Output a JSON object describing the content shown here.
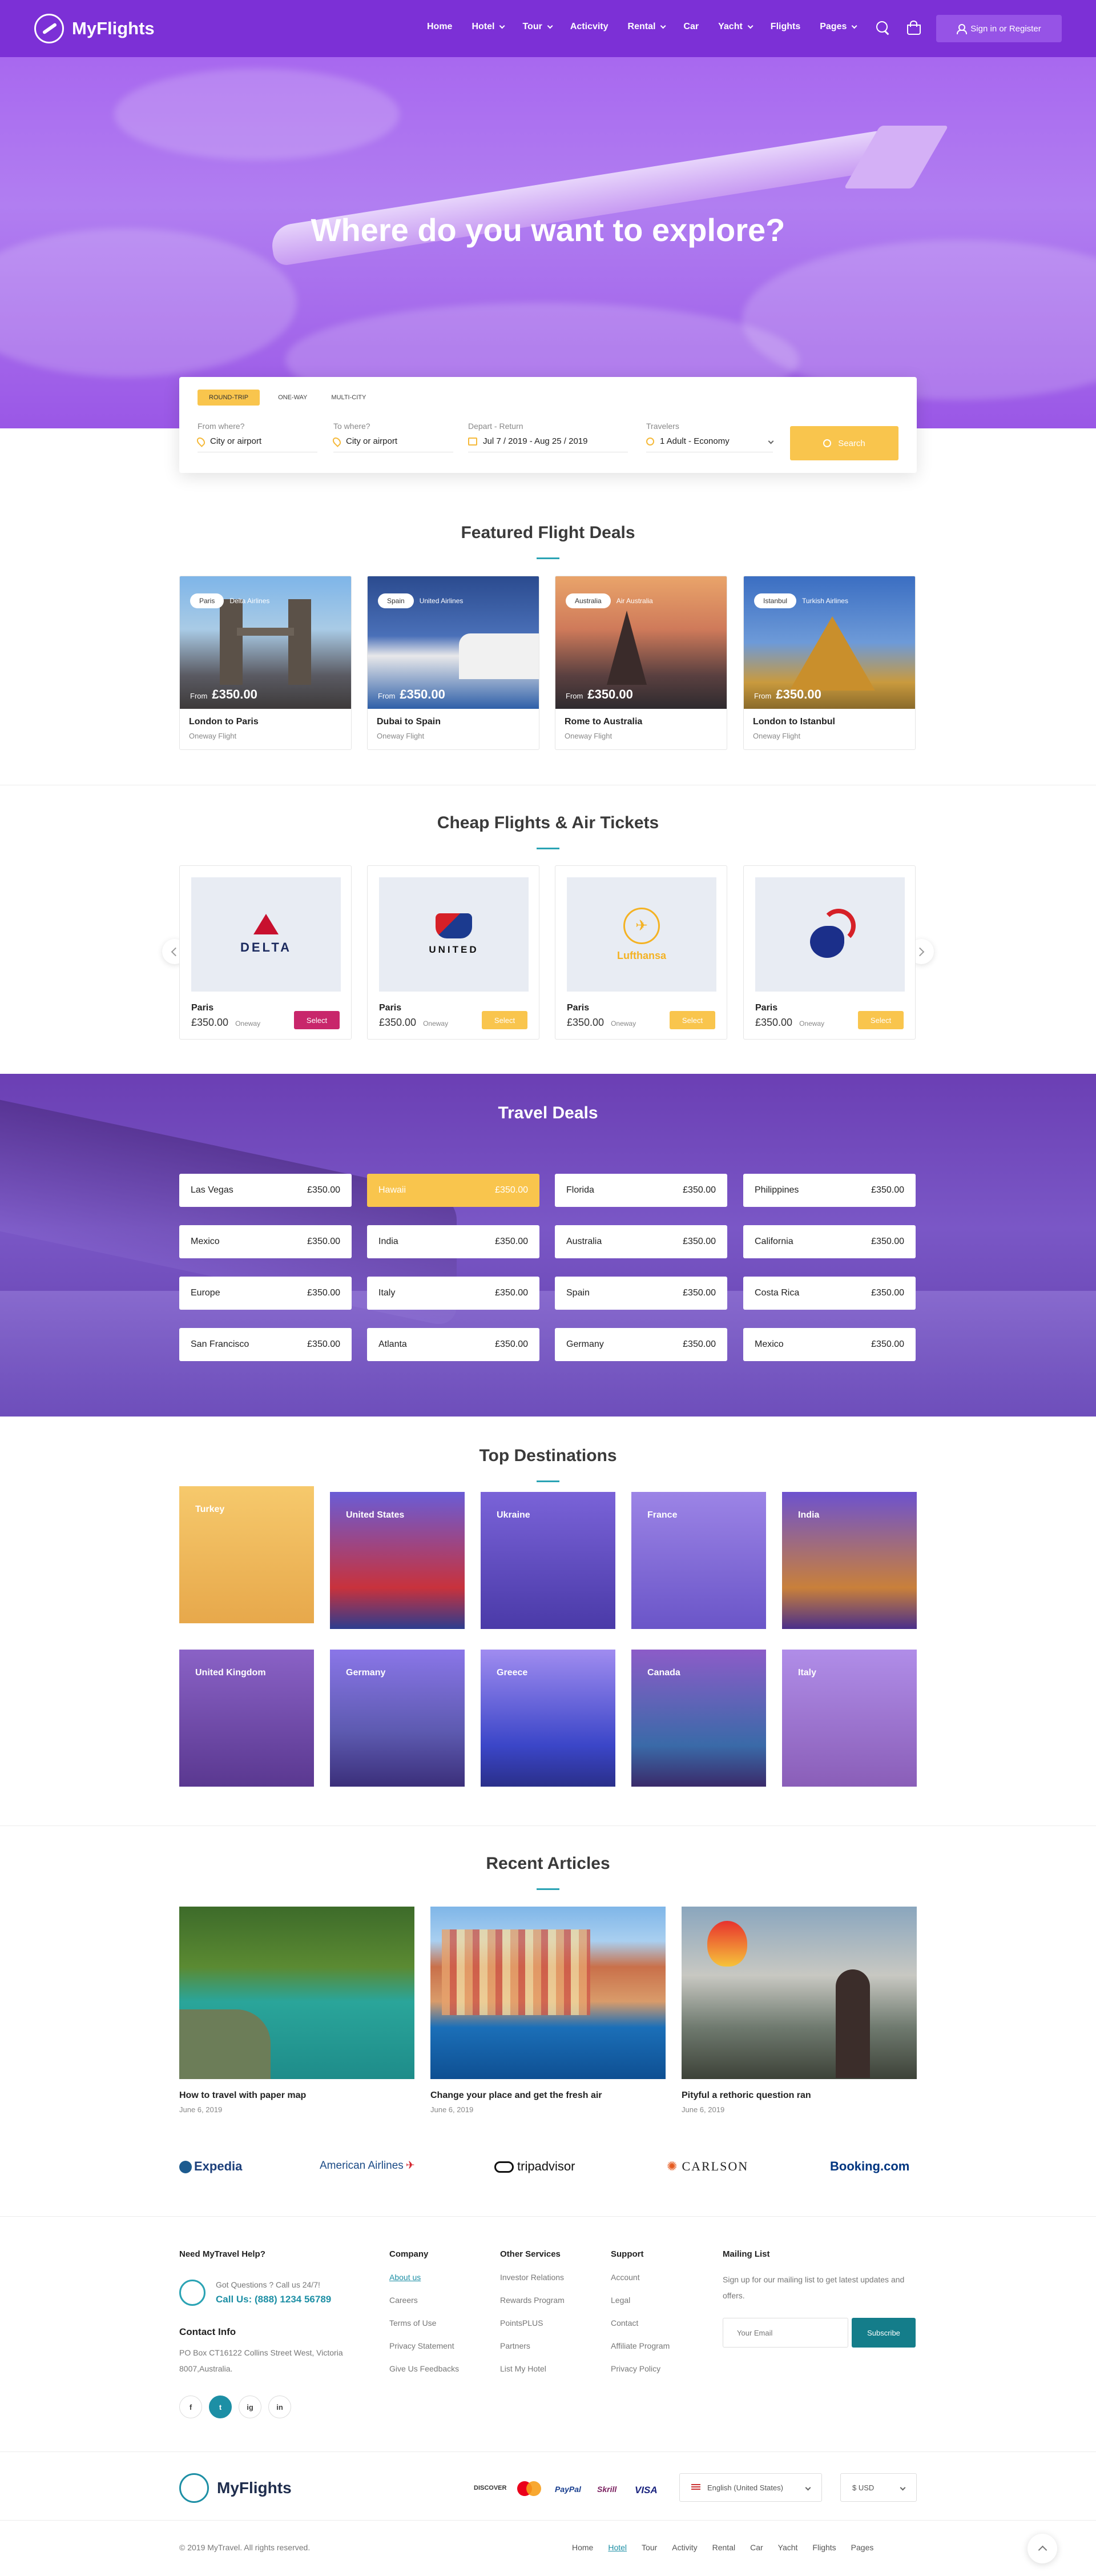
{
  "header": {
    "logo_text": "MyFlights",
    "nav": [
      {
        "label": "Home",
        "dropdown": false
      },
      {
        "label": "Hotel",
        "dropdown": true
      },
      {
        "label": "Tour",
        "dropdown": true
      },
      {
        "label": "Acticvity",
        "dropdown": false
      },
      {
        "label": "Rental",
        "dropdown": true
      },
      {
        "label": "Car",
        "dropdown": false
      },
      {
        "label": "Yacht",
        "dropdown": true
      },
      {
        "label": "Flights",
        "dropdown": false
      },
      {
        "label": "Pages",
        "dropdown": true
      }
    ],
    "signin_label": "Sign in or Register"
  },
  "hero": {
    "title": "Where do you want to explore?"
  },
  "search": {
    "tabs": [
      "ROUND-TRIP",
      "ONE-WAY",
      "MULTI-CITY"
    ],
    "from_label": "From where?",
    "from_value": "City or airport",
    "to_label": "To where?",
    "to_value": "City or airport",
    "date_label": "Depart - Return",
    "date_value": "Jul 7 / 2019 - Aug 25 / 2019",
    "travelers_label": "Travelers",
    "travelers_value": "1 Adult - Economy",
    "button_label": "Search"
  },
  "featured": {
    "title": "Featured Flight Deals",
    "deals": [
      {
        "tag": "Paris",
        "airline": "Delta Airlines",
        "from": "From",
        "price": "£350.00",
        "name": "London to Paris",
        "sub": "Oneway Flight"
      },
      {
        "tag": "Spain",
        "airline": "United Airlines",
        "from": "From",
        "price": "£350.00",
        "name": "Dubai to Spain",
        "sub": "Oneway Flight"
      },
      {
        "tag": "Australia",
        "airline": "Air Australia",
        "from": "From",
        "price": "£350.00",
        "name": "Rome to Australia",
        "sub": "Oneway Flight"
      },
      {
        "tag": "Istanbul",
        "airline": "Turkish Airlines",
        "from": "From",
        "price": "£350.00",
        "name": "London to Istanbul",
        "sub": "Oneway Flight"
      }
    ]
  },
  "cheap": {
    "title": "Cheap Flights & Air Tickets",
    "cards": [
      {
        "logo": "DELTA",
        "city": "Paris",
        "price": "£350.00",
        "type": "Oneway",
        "button": "Select",
        "button_color": "#c8266b"
      },
      {
        "logo": "UNITED",
        "city": "Paris",
        "price": "£350.00",
        "type": "Oneway",
        "button": "Select",
        "button_color": "#f9c54d"
      },
      {
        "logo": "Lufthansa",
        "city": "Paris",
        "price": "£350.00",
        "type": "Oneway",
        "button": "Select",
        "button_color": "#f9c54d"
      },
      {
        "logo": "",
        "city": "Paris",
        "price": "£350.00",
        "type": "Oneway",
        "button": "Select",
        "button_color": "#f9c54d"
      }
    ]
  },
  "travel_deals": {
    "title": "Travel Deals",
    "items": [
      {
        "city": "Las Vegas",
        "price": "£350.00"
      },
      {
        "city": "Hawaii",
        "price": "£350.00",
        "highlight": true
      },
      {
        "city": "Florida",
        "price": "£350.00"
      },
      {
        "city": "Philippines",
        "price": "£350.00"
      },
      {
        "city": "Mexico",
        "price": "£350.00"
      },
      {
        "city": "India",
        "price": "£350.00"
      },
      {
        "city": "Australia",
        "price": "£350.00"
      },
      {
        "city": "California",
        "price": "£350.00"
      },
      {
        "city": "Europe",
        "price": "£350.00"
      },
      {
        "city": "Italy",
        "price": "£350.00"
      },
      {
        "city": "Spain",
        "price": "£350.00"
      },
      {
        "city": "Costa Rica",
        "price": "£350.00"
      },
      {
        "city": "San Francisco",
        "price": "£350.00"
      },
      {
        "city": "Atlanta",
        "price": "£350.00"
      },
      {
        "city": "Germany",
        "price": "£350.00"
      },
      {
        "city": "Mexico",
        "price": "£350.00"
      }
    ]
  },
  "destinations": {
    "title": "Top Destinations",
    "items": [
      "Turkey",
      "United States",
      "Ukraine",
      "France",
      "India",
      "United Kingdom",
      "Germany",
      "Greece",
      "Canada",
      "Italy"
    ]
  },
  "articles": {
    "title": "Recent Articles",
    "items": [
      {
        "title": "How to travel with paper map",
        "date": "June 6, 2019"
      },
      {
        "title": "Change your place and get the fresh air",
        "date": "June 6, 2019"
      },
      {
        "title": "Pityful a rethoric question ran",
        "date": "June 6, 2019"
      }
    ]
  },
  "brands": [
    "Expedia",
    "American Airlines",
    "tripadvisor",
    "CARLSON",
    "Booking.com"
  ],
  "footer": {
    "help_title": "Need MyTravel Help?",
    "help_question": "Got Questions ? Call us 24/7!",
    "help_phone": "Call Us: (888) 1234 56789",
    "contact_title": "Contact Info",
    "contact_address": "PO Box CT16122 Collins Street West, Victoria 8007,Australia.",
    "socials": [
      "f",
      "t",
      "ig",
      "in"
    ],
    "columns": [
      {
        "title": "Company",
        "links": [
          "About us",
          "Careers",
          "Terms of Use",
          "Privacy Statement",
          "Give Us Feedbacks"
        ]
      },
      {
        "title": "Other Services",
        "links": [
          "Investor Relations",
          "Rewards Program",
          "PointsPLUS",
          "Partners",
          "List My Hotel"
        ]
      },
      {
        "title": "Support",
        "links": [
          "Account",
          "Legal",
          "Contact",
          "Affiliate Program",
          "Privacy Policy"
        ]
      }
    ],
    "mailing_title": "Mailing List",
    "mailing_text": "Sign up for our mailing list to get latest updates and offers.",
    "email_placeholder": "Your Email",
    "subscribe_label": "Subscribe",
    "payments": [
      "DISCOVER",
      "mastercard",
      "PayPal",
      "Skrill",
      "VISA"
    ],
    "language": "English (United States)",
    "currency": "$ USD",
    "copyright": "© 2019 MyTravel. All rights reserved.",
    "bottom_nav": [
      "Home",
      "Hotel",
      "Tour",
      "Activity",
      "Rental",
      "Car",
      "Yacht",
      "Flights",
      "Pages"
    ]
  }
}
